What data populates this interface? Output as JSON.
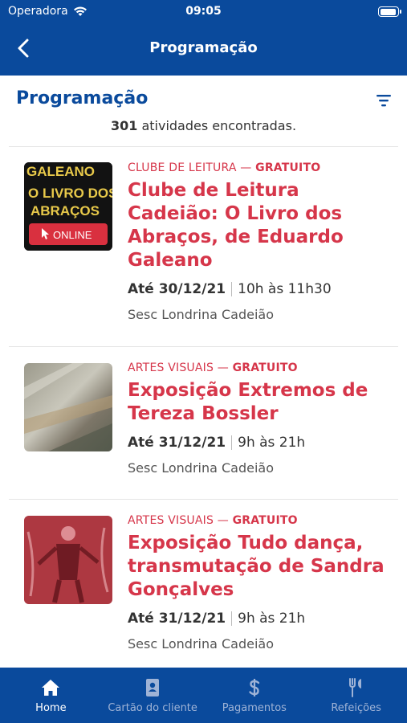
{
  "status_bar": {
    "carrier": "Operadora",
    "time": "09:05"
  },
  "nav": {
    "title": "Programação"
  },
  "header": {
    "title": "Programação",
    "count": "301",
    "count_suffix": "atividades encontradas."
  },
  "events": [
    {
      "category": "CLUBE DE LEITURA —",
      "price": "GRATUITO",
      "title": "Clube de Leitura Cadeião: O Livro dos Abraços, de Eduardo Galeano",
      "date": "Até 30/12/21",
      "hours": "10h às 11h30",
      "place": "Sesc Londrina Cadeião",
      "thumb_lines": [
        "GALEANO",
        "O LIVRO DOS",
        "ABRAÇOS"
      ],
      "thumb_badge": "ONLINE"
    },
    {
      "category": "ARTES VISUAIS —",
      "price": "GRATUITO",
      "title": "Exposição Extremos de Tereza Bossler",
      "date": "Até 31/12/21",
      "hours": "9h às 21h",
      "place": "Sesc Londrina Cadeião"
    },
    {
      "category": "ARTES VISUAIS —",
      "price": "GRATUITO",
      "title": "Exposição Tudo dança, transmutação de Sandra Gonçalves",
      "date": "Até 31/12/21",
      "hours": "9h às 21h",
      "place": "Sesc Londrina Cadeião"
    }
  ],
  "tabs": [
    {
      "label": "Home",
      "icon": "home-icon",
      "active": true
    },
    {
      "label": "Cartão do cliente",
      "icon": "id-card-icon",
      "active": false
    },
    {
      "label": "Pagamentos",
      "icon": "dollar-icon",
      "active": false
    },
    {
      "label": "Refeições",
      "icon": "fork-knife-icon",
      "active": false
    }
  ],
  "colors": {
    "brand_blue": "#0a4a9c",
    "accent_red": "#d6364a"
  }
}
